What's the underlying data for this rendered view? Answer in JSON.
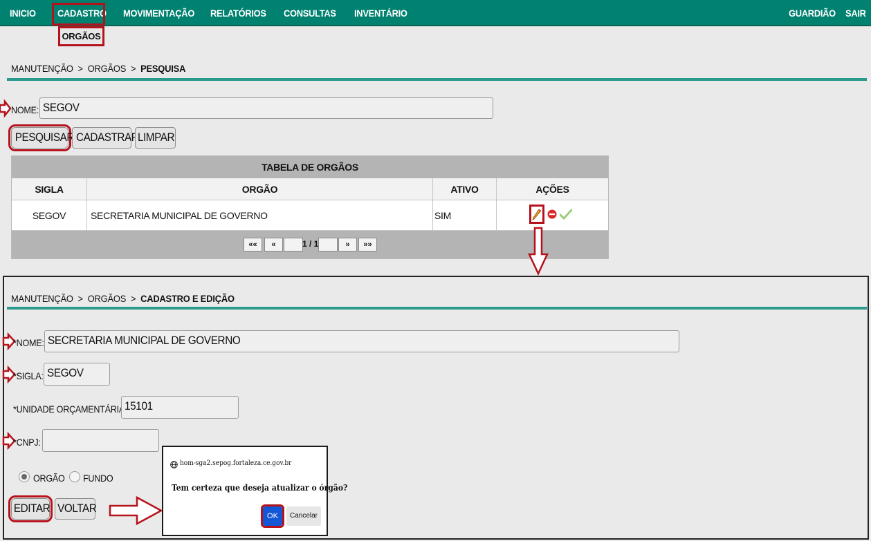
{
  "nav": {
    "items": [
      "INICIO",
      "CADASTRO",
      "MOVIMENTAÇÃO",
      "RELATÓRIOS",
      "CONSULTAS",
      "INVENTÁRIO"
    ],
    "right_items": [
      "GUARDIÃO",
      "SAIR"
    ],
    "submenu_item": "ORGÃOS"
  },
  "search_page": {
    "breadcrumb": [
      "MANUTENÇÃO",
      ">",
      "ORGÃOS",
      ">",
      "PESQUISA"
    ],
    "name_label": "NOME:",
    "name_value": "SEGOV",
    "buttons": {
      "search": "PESQUISAR",
      "register": "CADASTRAR",
      "clear": "LIMPAR"
    },
    "table": {
      "caption": "TABELA DE ORGÃOS",
      "headers": [
        "SIGLA",
        "ORGÃO",
        "ATIVO",
        "AÇÕES"
      ],
      "rows": [
        {
          "sigla": "SEGOV",
          "orgao": "SECRETARIA MUNICIPAL DE GOVERNO",
          "ativo": "SIM"
        }
      ],
      "pager": {
        "first": "««",
        "prev": "«",
        "page": "1 / 1",
        "next": "»",
        "last": "»»"
      }
    }
  },
  "edit_page": {
    "breadcrumb": [
      "MANUTENÇÃO",
      ">",
      "ORGÃOS",
      ">",
      "CADASTRO E EDIÇÃO"
    ],
    "fields": {
      "nome_label": "*NOME:",
      "nome_value": "SECRETARIA MUNICIPAL DE GOVERNO",
      "sigla_label": "*SIGLA:",
      "sigla_value": "SEGOV",
      "unidade_label": "*UNIDADE ORÇAMENTÁRIA:",
      "unidade_value": "15101",
      "cnpj_label": "*CNPJ:",
      "cnpj_value": ""
    },
    "radio": {
      "option1": "ORGÃO",
      "option2": "FUNDO",
      "selected": "ORGÃO"
    },
    "buttons": {
      "edit": "EDITAR",
      "back": "VOLTAR"
    }
  },
  "dialog": {
    "host": "hom-sga2.sepog.fortaleza.ce.gov.br",
    "message": "Tem certeza que deseja atualizar o órgão?",
    "ok": "OK",
    "cancel": "Cancelar"
  },
  "colors": {
    "nav_bg": "#018170",
    "accent_line": "#2a9a8c",
    "highlight_red": "#b5121b",
    "ok_blue": "#1457d6"
  }
}
